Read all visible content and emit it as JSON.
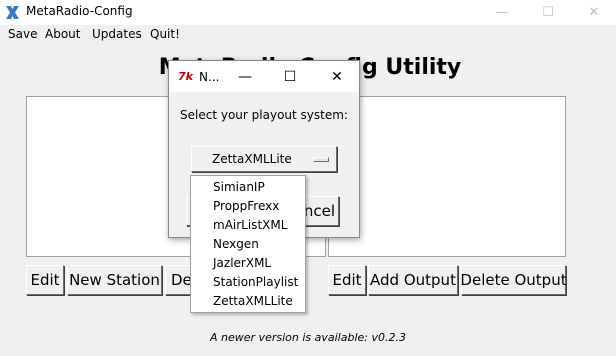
{
  "window": {
    "title": "MetaRadio-Config"
  },
  "menu": [
    "Save",
    "About",
    "Updates",
    "Quit!"
  ],
  "heading": "MetaRadio Config Utility",
  "stations_buttons": {
    "edit": "Edit",
    "new": "New Station",
    "delete_partial": "De"
  },
  "outputs_buttons": {
    "edit": "Edit",
    "add": "Add Output",
    "delete": "Delete Output"
  },
  "status": "A newer version is available: v0.2.3",
  "dialog": {
    "title": "N...",
    "prompt": "Select your playout system:",
    "selected": "ZettaXMLLite",
    "cancel_partial": "ncel",
    "options": [
      "SimianIP",
      "ProppFrexx",
      "mAirListXML",
      "Nexgen",
      "JazlerXML",
      "StationPlaylist",
      "ZettaXMLLite"
    ]
  }
}
